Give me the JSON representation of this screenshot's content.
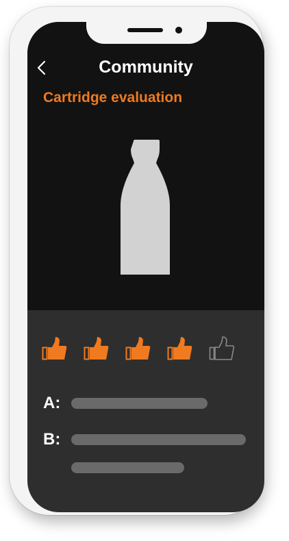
{
  "header": {
    "title": "Community",
    "back_icon": "chevron-left-icon"
  },
  "section": {
    "title": "Cartridge evaluation"
  },
  "colors": {
    "accent": "#f07a1f",
    "background_top": "#121212",
    "background_bottom": "#2e2e2e",
    "cartridge": "#d2d2d2",
    "placeholder_bar": "#6a6a6a"
  },
  "rating": {
    "value": 4,
    "max": 5,
    "icon": "thumbs-up-icon"
  },
  "fields": [
    {
      "label": "A:"
    },
    {
      "label": "B:"
    }
  ]
}
